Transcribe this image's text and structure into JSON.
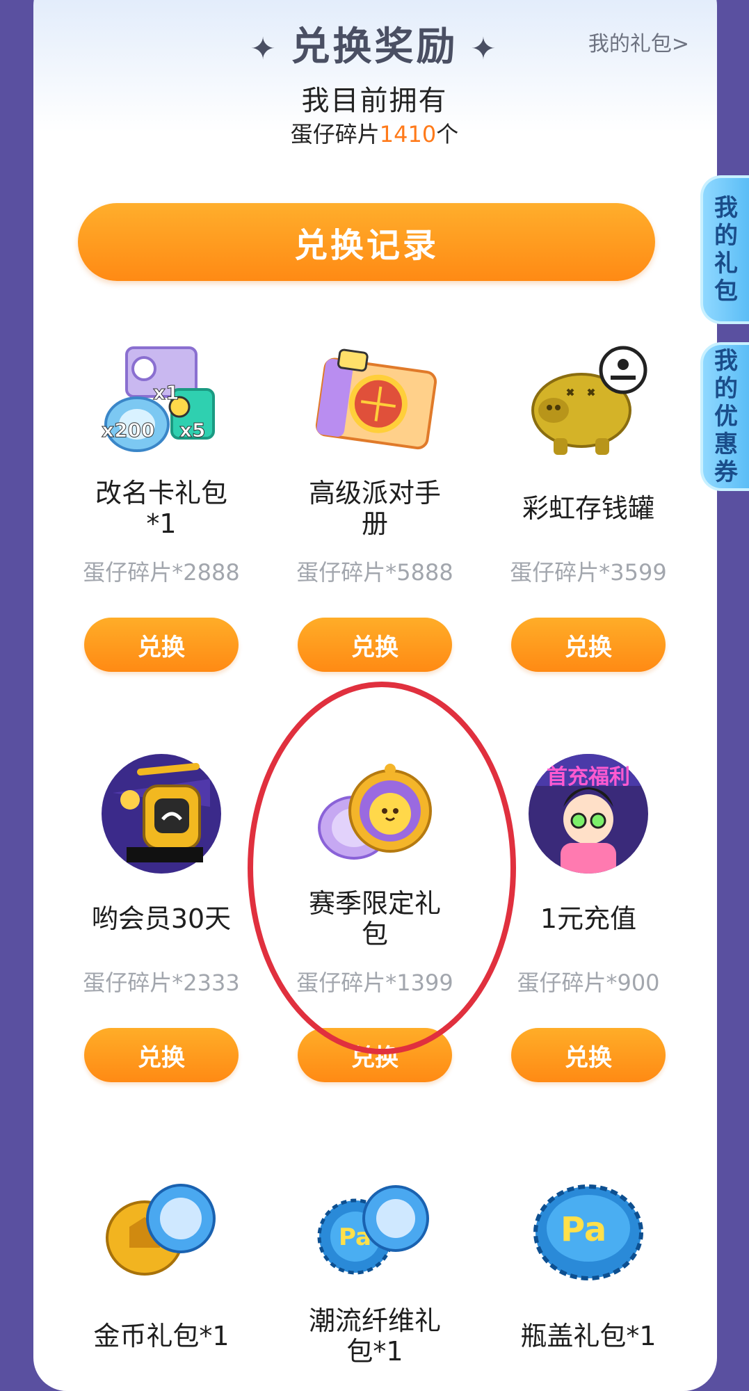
{
  "header": {
    "title": "兑换奖励",
    "my_gift_link": "我的礼包>"
  },
  "summary": {
    "own_label": "我目前拥有",
    "currency_prefix": "蛋仔碎片",
    "currency_count": "1410",
    "currency_suffix": "个"
  },
  "history_button": "兑换记录",
  "side_tabs": [
    {
      "label": [
        "我",
        "的",
        "礼",
        "包"
      ]
    },
    {
      "label": [
        "我",
        "的",
        "优",
        "惠",
        "券"
      ]
    }
  ],
  "items": [
    {
      "name": "改名卡礼包*1",
      "cost": "蛋仔碎片*2888",
      "button": "兑换",
      "icon": "rename-card-gift-icon",
      "badges": [
        "x1",
        "x200",
        "x5"
      ]
    },
    {
      "name": "高级派对手册",
      "cost": "蛋仔碎片*5888",
      "button": "兑换",
      "icon": "party-handbook-icon"
    },
    {
      "name": "彩虹存钱罐",
      "cost": "蛋仔碎片*3599",
      "button": "兑换",
      "icon": "piggy-bank-icon"
    },
    {
      "name": "哟会员30天",
      "cost": "蛋仔碎片*2333",
      "button": "兑换",
      "icon": "membership-icon"
    },
    {
      "name": "赛季限定礼包",
      "cost": "蛋仔碎片*1399",
      "button": "兑换",
      "icon": "season-gift-icon"
    },
    {
      "name": "1元充值",
      "cost": "蛋仔碎片*900",
      "button": "兑换",
      "icon": "recharge-icon",
      "banner": "首充福利"
    },
    {
      "name": "金币礼包*1",
      "cost": "",
      "button": "",
      "icon": "coin-gift-icon"
    },
    {
      "name": "潮流纤维礼包*1",
      "cost": "",
      "button": "",
      "icon": "fiber-gift-icon"
    },
    {
      "name": "瓶盖礼包*1",
      "cost": "",
      "button": "",
      "icon": "bottle-cap-gift-icon"
    }
  ]
}
